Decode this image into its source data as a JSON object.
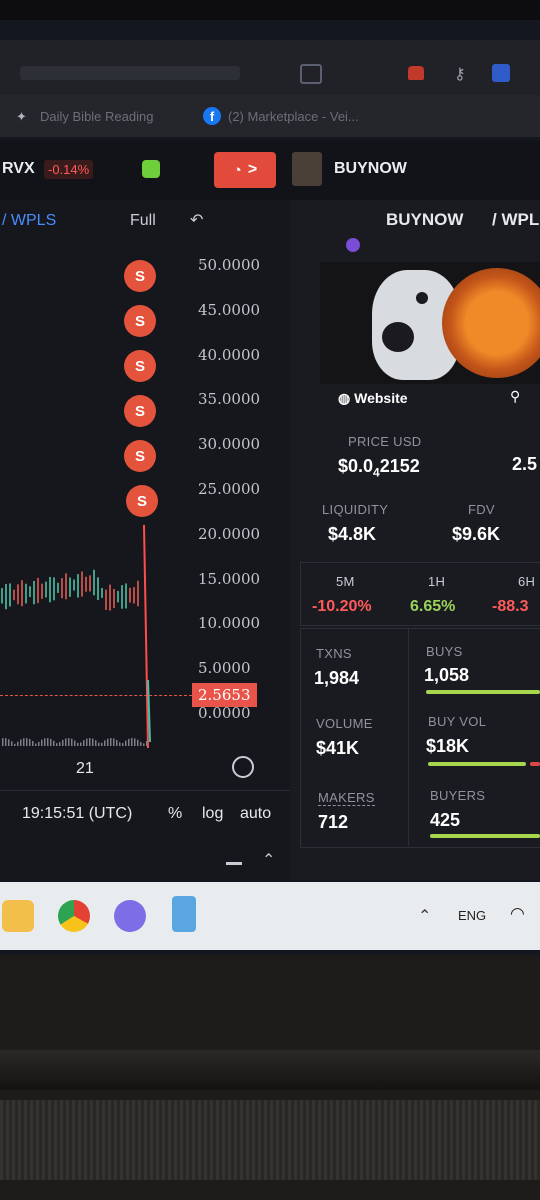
{
  "header": {
    "ticker": "RVX",
    "ticker_change": "-0.14%",
    "fire_label": ">",
    "buynow_label": "BUYNOW"
  },
  "bookmarks": {
    "item1": "Daily Bible Reading",
    "item2": "(2) Marketplace - Vei..."
  },
  "chart": {
    "pair": "/ WPLS",
    "full_label": "Full",
    "y_ticks": [
      "50.0000",
      "45.0000",
      "40.0000",
      "35.0000",
      "30.0000",
      "25.0000",
      "20.0000",
      "15.0000",
      "10.0000",
      "5.0000",
      "0.0000"
    ],
    "current_price": "2.5653",
    "x_label": "21",
    "time": "19:15:51 (UTC)",
    "pct_label": "%",
    "log_label": "log",
    "auto_label": "auto",
    "sell_marker": "S"
  },
  "token": {
    "title": "BUYNOW",
    "pair_suffix": "/ WPL",
    "website_label": "Website",
    "price_label": "PRICE USD",
    "price_value_a": "$0.0",
    "price_value_sub": "4",
    "price_value_b": "2152",
    "price_other": "2.5",
    "liquidity_label": "LIQUIDITY",
    "liquidity_value": "$4.8K",
    "fdv_label": "FDV",
    "fdv_value": "$9.6K",
    "tf_5m": "5M",
    "tf_5m_value": "-10.20%",
    "tf_1h": "1H",
    "tf_1h_value": "6.65%",
    "tf_6h": "6H",
    "tf_6h_value": "-88.3",
    "txns_label": "TXNS",
    "txns_value": "1,984",
    "buys_label": "BUYS",
    "buys_value": "1,058",
    "volume_label": "VOLUME",
    "volume_value": "$41K",
    "buyvol_label": "BUY VOL",
    "buyvol_value": "$18K",
    "makers_label": "MAKERS",
    "makers_value": "712",
    "buyers_label": "BUYERS",
    "buyers_value": "425"
  },
  "taskbar": {
    "lang": "ENG"
  },
  "colors": {
    "sell": "#e4533c",
    "green": "#9bd35a",
    "red": "#ff5a5a"
  }
}
